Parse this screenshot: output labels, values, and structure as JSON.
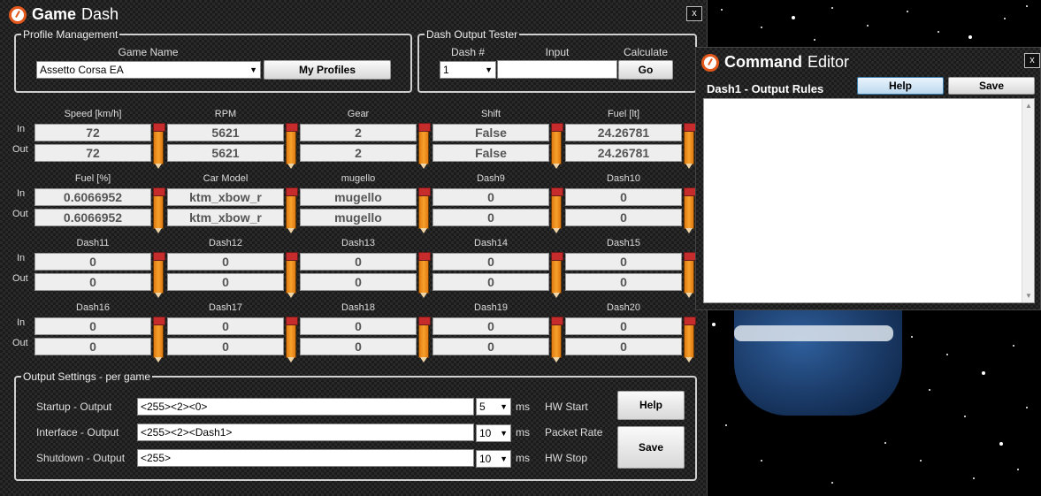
{
  "game_dash": {
    "title_bold": "Game",
    "title_rest": "Dash",
    "close": "x",
    "profile": {
      "legend": "Profile Management",
      "game_name_label": "Game Name",
      "game_name_value": "Assetto Corsa EA",
      "my_profiles": "My Profiles"
    },
    "tester": {
      "legend": "Dash Output Tester",
      "dash_label": "Dash #",
      "dash_value": "1",
      "input_label": "Input",
      "input_value": "",
      "calc_label": "Calculate",
      "go": "Go"
    },
    "row_labels": {
      "in": "In",
      "out": "Out"
    },
    "dash_groups": [
      {
        "cells": [
          {
            "header": "Speed [km/h]",
            "in": "72",
            "out": "72"
          },
          {
            "header": "RPM",
            "in": "5621",
            "out": "5621"
          },
          {
            "header": "Gear",
            "in": "2",
            "out": "2"
          },
          {
            "header": "Shift",
            "in": "False",
            "out": "False"
          },
          {
            "header": "Fuel [lt]",
            "in": "24.26781",
            "out": "24.26781"
          }
        ]
      },
      {
        "cells": [
          {
            "header": "Fuel [%]",
            "in": "0.6066952",
            "out": "0.6066952"
          },
          {
            "header": "Car Model",
            "in": "ktm_xbow_r",
            "out": "ktm_xbow_r"
          },
          {
            "header": "mugello",
            "in": "mugello",
            "out": "mugello"
          },
          {
            "header": "Dash9",
            "in": "0",
            "out": "0"
          },
          {
            "header": "Dash10",
            "in": "0",
            "out": "0"
          }
        ]
      },
      {
        "cells": [
          {
            "header": "Dash11",
            "in": "0",
            "out": "0"
          },
          {
            "header": "Dash12",
            "in": "0",
            "out": "0"
          },
          {
            "header": "Dash13",
            "in": "0",
            "out": "0"
          },
          {
            "header": "Dash14",
            "in": "0",
            "out": "0"
          },
          {
            "header": "Dash15",
            "in": "0",
            "out": "0"
          }
        ]
      },
      {
        "cells": [
          {
            "header": "Dash16",
            "in": "0",
            "out": "0"
          },
          {
            "header": "Dash17",
            "in": "0",
            "out": "0"
          },
          {
            "header": "Dash18",
            "in": "0",
            "out": "0"
          },
          {
            "header": "Dash19",
            "in": "0",
            "out": "0"
          },
          {
            "header": "Dash20",
            "in": "0",
            "out": "0"
          }
        ]
      }
    ],
    "output": {
      "legend": "Output Settings - per game",
      "startup_label": "Startup - Output",
      "startup_value": "<255><2><0>",
      "startup_ms": "5",
      "hw_start": "HW Start",
      "interface_label": "Interface - Output",
      "interface_value": "<255><2><Dash1>",
      "interface_ms": "10",
      "packet_rate": "Packet Rate",
      "shutdown_label": "Shutdown - Output",
      "shutdown_value": "<255>",
      "shutdown_ms": "10",
      "hw_stop": "HW Stop",
      "ms_unit": "ms",
      "help": "Help",
      "save": "Save"
    }
  },
  "command_editor": {
    "title_bold": "Command",
    "title_rest": "Editor",
    "close": "x",
    "subtitle": "Dash1 - Output Rules",
    "help": "Help",
    "save": "Save",
    "rules_text": ""
  }
}
